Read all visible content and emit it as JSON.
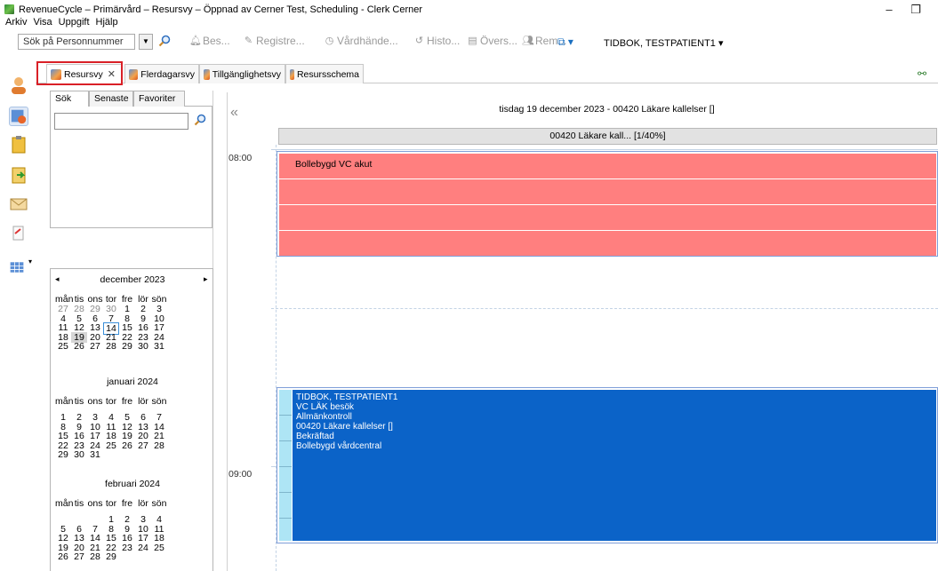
{
  "window": {
    "title": "RevenueCycle – Primärvård – Resursvy – Öppnad av Cerner Test, Scheduling - Clerk Cerner",
    "minimize": "–",
    "restore": "❐"
  },
  "menu": [
    "Arkiv",
    "Visa",
    "Uppgift",
    "Hjälp"
  ],
  "toolbar": {
    "search_value": "Sök på Personnummer",
    "items": [
      "Bes...",
      "Registre...",
      "Vårdhände...",
      "Histo...",
      "Övers...",
      "Rem..."
    ],
    "patient": "TIDBOK, TESTPATIENT1"
  },
  "tabs": [
    {
      "label": "Resursvy",
      "close": "✕"
    },
    {
      "label": "Flerdagarsvy"
    },
    {
      "label": "Tillgänglighetsvy"
    },
    {
      "label": "Resursschema"
    }
  ],
  "left_panel": {
    "tabs": [
      "Sök",
      "Senaste",
      "Favoriter"
    ],
    "search_value": ""
  },
  "calendar": {
    "prev": "◂",
    "next": "▸",
    "weekdays": [
      "mån",
      "tis",
      "ons",
      "tor",
      "fre",
      "lör",
      "sön"
    ],
    "months": [
      {
        "name": "december 2023",
        "weeks": [
          [
            "27",
            "28",
            "29",
            "30",
            "1",
            "2",
            "3"
          ],
          [
            "4",
            "5",
            "6",
            "7",
            "8",
            "9",
            "10"
          ],
          [
            "11",
            "12",
            "13",
            "14",
            "15",
            "16",
            "17"
          ],
          [
            "18",
            "19",
            "20",
            "21",
            "22",
            "23",
            "24"
          ],
          [
            "25",
            "26",
            "27",
            "28",
            "29",
            "30",
            "31"
          ]
        ]
      },
      {
        "name": "januari 2024",
        "weeks": [
          [
            "1",
            "2",
            "3",
            "4",
            "5",
            "6",
            "7"
          ],
          [
            "8",
            "9",
            "10",
            "11",
            "12",
            "13",
            "14"
          ],
          [
            "15",
            "16",
            "17",
            "18",
            "19",
            "20",
            "21"
          ],
          [
            "22",
            "23",
            "24",
            "25",
            "26",
            "27",
            "28"
          ],
          [
            "29",
            "30",
            "31",
            "",
            "",
            "",
            ""
          ]
        ]
      },
      {
        "name": "februari 2024",
        "weeks": [
          [
            "",
            "",
            "",
            "1",
            "2",
            "3",
            "4"
          ],
          [
            "5",
            "6",
            "7",
            "8",
            "9",
            "10",
            "11"
          ],
          [
            "12",
            "13",
            "14",
            "15",
            "16",
            "17",
            "18"
          ],
          [
            "19",
            "20",
            "21",
            "22",
            "23",
            "24",
            "25"
          ],
          [
            "26",
            "27",
            "28",
            "29",
            "",
            "",
            ""
          ]
        ]
      }
    ],
    "today": "14",
    "selected": "19"
  },
  "schedule": {
    "collapse": "«",
    "date_header": "tisdag 19 december 2023 - 00420 Läkare kallelser []",
    "resource_header": "00420 Läkare kall... [1/40%]",
    "time_0800": "08:00",
    "time_0900": "09:00",
    "blocked_label": "Bollebygd VC akut",
    "appointment": [
      "TIDBOK, TESTPATIENT1",
      "VC LÄK besök",
      "Allmänkontroll",
      "00420 Läkare kallelser []",
      "Bekräftad",
      "Bollebygd vårdcentral"
    ],
    "colors": {
      "blocked": "#ff7f7f",
      "appointment": "#0b63c8",
      "appointment_strip": "#aee5f5"
    }
  }
}
